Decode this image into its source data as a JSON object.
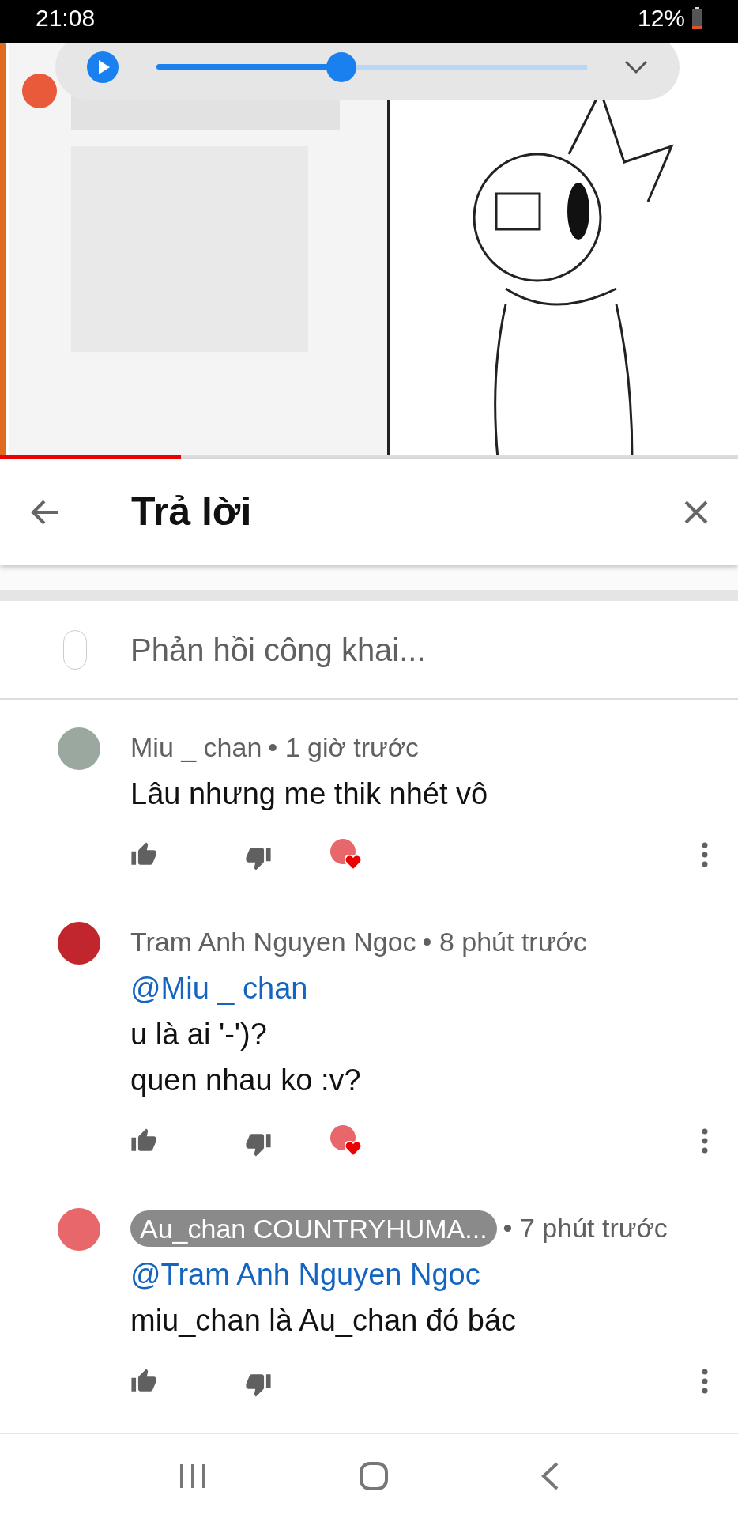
{
  "status_bar": {
    "time": "21:08",
    "battery": "12%"
  },
  "media_control": {
    "level": 0.43
  },
  "video": {
    "kind": "picture",
    "progress": {
      "level": 0.245
    }
  },
  "header": {
    "title": "Trả lời"
  },
  "reply_field": {
    "placeholder": "Phản hồi công khai..."
  },
  "comments": [
    {
      "author": "Miu _ chan",
      "author_highlighted": false,
      "time": "• 1 giờ trước",
      "lines": [
        "Lâu nhưng me thik nhét vô"
      ],
      "hearted": true,
      "color": "#9aa8a0"
    },
    {
      "author": "Tram Anh Nguyen Ngoc",
      "author_highlighted": false,
      "time": "• 8 phút trước",
      "mention": "@Miu _ chan",
      "lines": [
        "u là ai '-')?",
        "quen nhau ko :v?"
      ],
      "hearted": true,
      "color": "#c0262b"
    },
    {
      "author": "Au_chan COUNTRYHUMA...",
      "author_highlighted": true,
      "time": "• 7 phút trước",
      "mention": "@Tram Anh Nguyen Ngoc",
      "lines": [
        "miu_chan là Au_chan đó bác"
      ],
      "hearted": false,
      "color": "#e8676a"
    }
  ]
}
